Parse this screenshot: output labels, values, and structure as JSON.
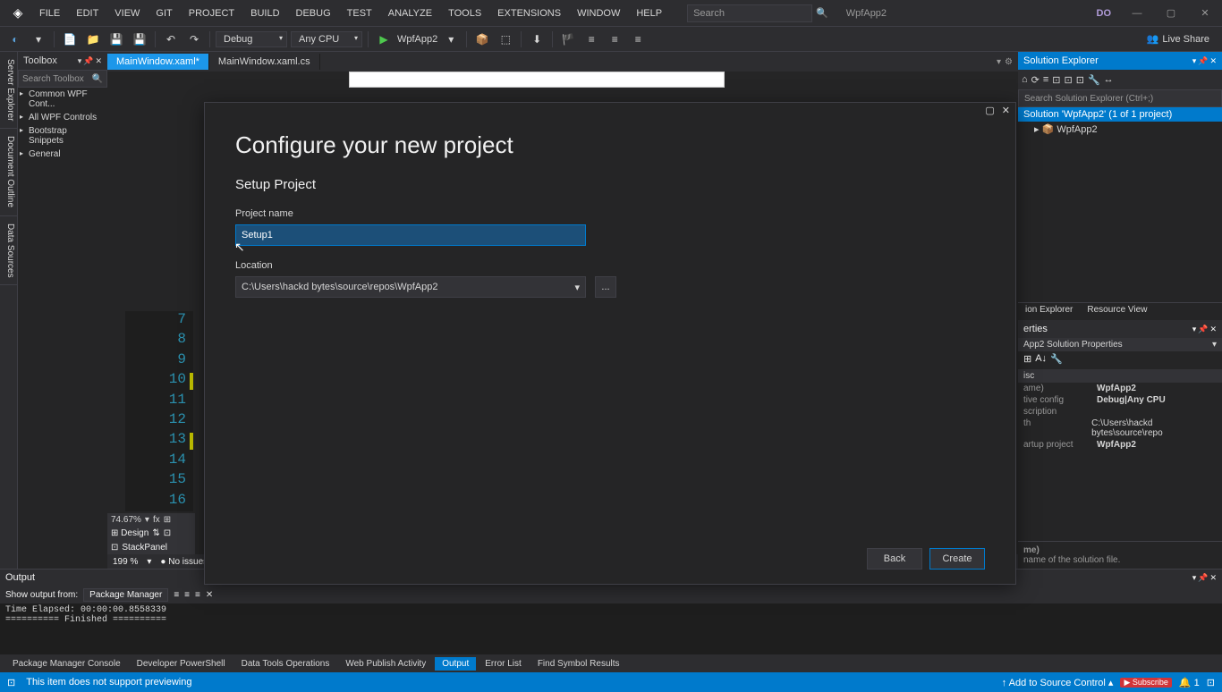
{
  "titlebar": {
    "menus": [
      "FILE",
      "EDIT",
      "VIEW",
      "GIT",
      "PROJECT",
      "BUILD",
      "DEBUG",
      "TEST",
      "ANALYZE",
      "TOOLS",
      "EXTENSIONS",
      "WINDOW",
      "HELP"
    ],
    "search_placeholder": "Search",
    "appname": "WpfApp2",
    "user": "DO"
  },
  "toolbar": {
    "config": "Debug",
    "platform": "Any CPU",
    "startup": "WpfApp2",
    "liveshare": "Live Share"
  },
  "toolbox": {
    "title": "Toolbox",
    "search": "Search Toolbox",
    "items": [
      "Common WPF Cont...",
      "All WPF Controls",
      "Bootstrap Snippets",
      "General"
    ]
  },
  "vtabs": [
    "Server Explorer",
    "Document Outline",
    "Data Sources"
  ],
  "tabs": [
    {
      "label": "MainWindow.xaml*",
      "active": true
    },
    {
      "label": "MainWindow.xaml.cs",
      "active": false
    }
  ],
  "designer": {
    "zoom": "74.67%",
    "design": "Design",
    "stack": "StackPanel",
    "zoom2": "199 %",
    "issues": "No issues"
  },
  "linenums": [
    7,
    8,
    9,
    10,
    11,
    12,
    13,
    14,
    15,
    16
  ],
  "marked": [
    10,
    13
  ],
  "solexp": {
    "title": "Solution Explorer",
    "search": "Search Solution Explorer (Ctrl+;)",
    "solution": "Solution 'WpfApp2' (1 of 1 project)",
    "project": "WpfApp2",
    "tabs": [
      "ion Explorer",
      "Resource View"
    ]
  },
  "props": {
    "title": "erties",
    "obj": "App2",
    "objtype": "Solution Properties",
    "cat": "isc",
    "rows": [
      {
        "k": "ame)",
        "v": "WpfApp2",
        "bold": true
      },
      {
        "k": "tive config",
        "v": "Debug|Any CPU",
        "bold": true
      },
      {
        "k": "scription",
        "v": ""
      },
      {
        "k": "th",
        "v": "C:\\Users\\hackd bytes\\source\\repo"
      },
      {
        "k": "artup project",
        "v": "WpfApp2",
        "bold": true
      }
    ],
    "descname": "me)",
    "desc": "name of the solution file."
  },
  "output": {
    "title": "Output",
    "from_label": "Show output from:",
    "from": "Package Manager",
    "content": "Time Elapsed: 00:00:00.8558339\n========== Finished =========="
  },
  "btabs": [
    "Package Manager Console",
    "Developer PowerShell",
    "Data Tools Operations",
    "Web Publish Activity",
    "Output",
    "Error List",
    "Find Symbol Results"
  ],
  "btabs_active": 4,
  "status": {
    "msg": "This item does not support previewing",
    "src": "Add to Source Control",
    "notif": "1"
  },
  "dialog": {
    "title": "Configure your new project",
    "subtitle": "Setup Project",
    "name_label": "Project name",
    "name_value": "Setup1",
    "loc_label": "Location",
    "loc_value": "C:\\Users\\hackd bytes\\source\\repos\\WpfApp2",
    "browse": "...",
    "back": "Back",
    "create": "Create"
  }
}
